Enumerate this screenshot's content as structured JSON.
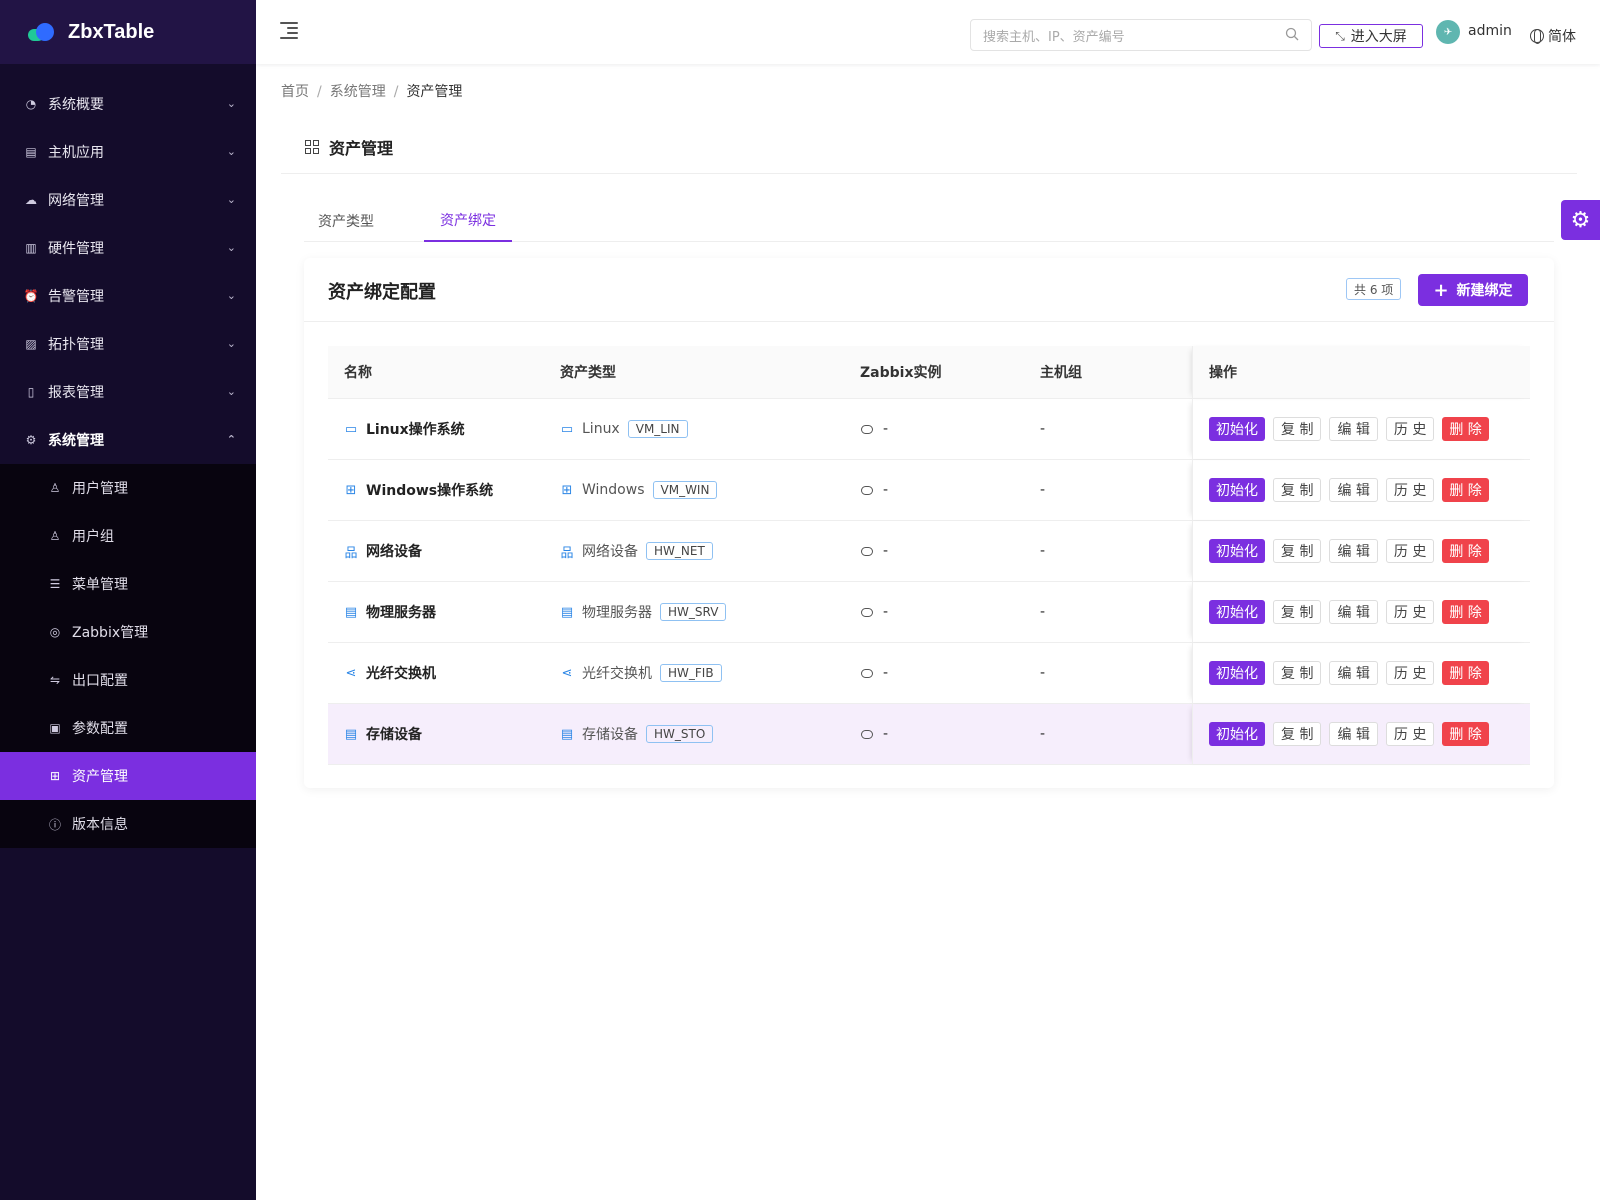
{
  "app": {
    "title": "ZbxTable"
  },
  "sidebar": {
    "items": [
      {
        "label": "系统概要",
        "icon": "dashboard-icon"
      },
      {
        "label": "主机应用",
        "icon": "host-icon"
      },
      {
        "label": "网络管理",
        "icon": "cloud-icon"
      },
      {
        "label": "硬件管理",
        "icon": "server-icon"
      },
      {
        "label": "告警管理",
        "icon": "alarm-icon"
      },
      {
        "label": "拓扑管理",
        "icon": "image-icon"
      },
      {
        "label": "报表管理",
        "icon": "file-icon"
      },
      {
        "label": "系统管理",
        "icon": "gear-icon"
      }
    ],
    "sub_items": [
      {
        "label": "用户管理",
        "icon": "user-icon"
      },
      {
        "label": "用户组",
        "icon": "users-icon"
      },
      {
        "label": "菜单管理",
        "icon": "menu-icon"
      },
      {
        "label": "Zabbix管理",
        "icon": "zabbix-icon"
      },
      {
        "label": "出口配置",
        "icon": "swap-icon"
      },
      {
        "label": "参数配置",
        "icon": "params-icon"
      },
      {
        "label": "资产管理",
        "icon": "grid-icon"
      },
      {
        "label": "版本信息",
        "icon": "info-icon"
      }
    ]
  },
  "topbar": {
    "search_placeholder": "搜索主机、IP、资产编号",
    "bigscreen_label": "进入大屏",
    "username": "admin",
    "language": "简体"
  },
  "breadcrumb": [
    "首页",
    "系统管理",
    "资产管理"
  ],
  "page": {
    "title": "资产管理"
  },
  "tabs": [
    "资产类型",
    "资产绑定"
  ],
  "card": {
    "title": "资产绑定配置",
    "count": "共 6 项",
    "new_button": "新建绑定"
  },
  "table": {
    "headers": [
      "名称",
      "资产类型",
      "Zabbix实例",
      "主机组",
      "操作"
    ],
    "actions": {
      "init": "初始化",
      "copy": "复 制",
      "edit": "编 辑",
      "history": "历 史",
      "delete": "删 除"
    },
    "rows": [
      {
        "name": "Linux操作系统",
        "type": "Linux",
        "code": "VM_LIN",
        "zabbix": "-",
        "group": "-",
        "icon": "monitor-icon"
      },
      {
        "name": "Windows操作系统",
        "type": "Windows",
        "code": "VM_WIN",
        "zabbix": "-",
        "group": "-",
        "icon": "windows-icon"
      },
      {
        "name": "网络设备",
        "type": "网络设备",
        "code": "HW_NET",
        "zabbix": "-",
        "group": "-",
        "icon": "network-icon"
      },
      {
        "name": "物理服务器",
        "type": "物理服务器",
        "code": "HW_SRV",
        "zabbix": "-",
        "group": "-",
        "icon": "server-icon"
      },
      {
        "name": "光纤交换机",
        "type": "光纤交换机",
        "code": "HW_FIB",
        "zabbix": "-",
        "group": "-",
        "icon": "share-icon"
      },
      {
        "name": "存储设备",
        "type": "存储设备",
        "code": "HW_STO",
        "zabbix": "-",
        "group": "-",
        "icon": "storage-icon"
      }
    ]
  },
  "colors": {
    "accent": "#7b2fe0",
    "sidebar_bg": "#140c2b",
    "danger": "#f0434b",
    "link_icon": "#2b86e6"
  }
}
